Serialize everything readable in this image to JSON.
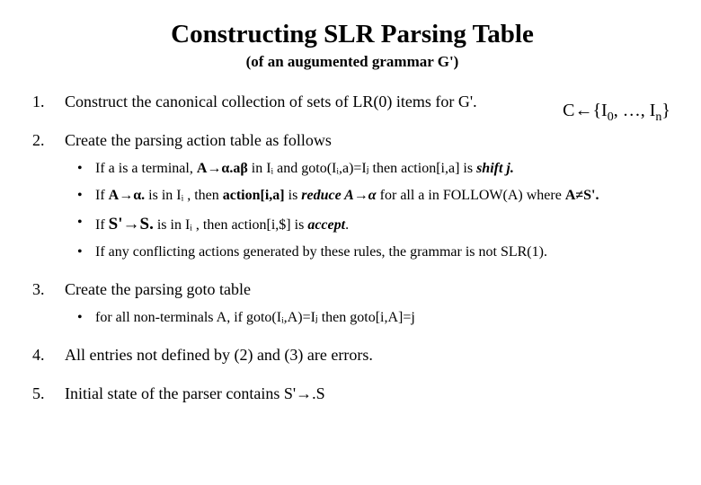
{
  "title": "Constructing SLR Parsing Table",
  "subtitle": "(of an augumented grammar G')",
  "csets": "C←{I₀, …, Iₙ}",
  "steps": {
    "s1": "Construct the canonical collection of sets of LR(0) items  for G'.",
    "s2": "Create the parsing action table as follows",
    "s2a_pre": "If  a is a terminal, ",
    "s2a_prod": "A→α.aβ",
    "s2a_mid": " in Iᵢ  and goto(Iᵢ,a)=Iⱼ  then action[i,a] is ",
    "s2a_act": "shift j.",
    "s2b_pre": "If  ",
    "s2b_prod": "A→α.",
    "s2b_mid1": "  is in Iᵢ , then ",
    "s2b_actlabel": "action[i,a]",
    "s2b_mid2": " is ",
    "s2b_act": "reduce A→α",
    "s2b_tail": "  for all a in FOLLOW(A)   where ",
    "s2b_cond": "A≠S'.",
    "s2c_pre": "If  ",
    "s2c_prod": "S'→S.",
    "s2c_mid": "  is in Iᵢ , then action[i,$] is ",
    "s2c_act": "accept",
    "s2c_dot": ".",
    "s2d": "If any conflicting actions generated by these rules, the grammar is not SLR(1).",
    "s3": "Create the parsing goto table",
    "s3a": "for all non-terminals A,  if goto(Iᵢ,A)=Iⱼ  then goto[i,A]=j",
    "s4": "All entries not defined by (2) and (3) are errors.",
    "s5": "Initial state of the parser contains  S'→.S"
  }
}
